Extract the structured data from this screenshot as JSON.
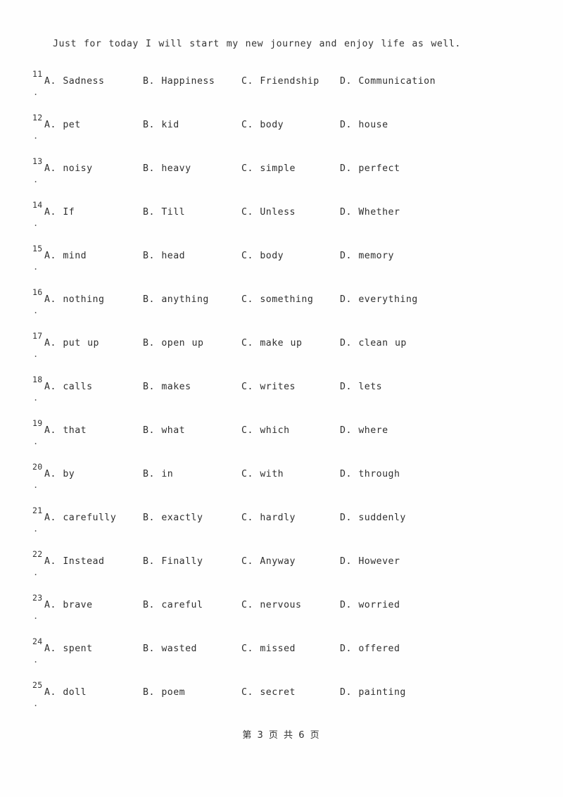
{
  "document": {
    "intro_line": "Just for today I will start my new journey and enjoy life as well.",
    "number_suffix": ".",
    "footer": "第 3 页 共 6 页"
  },
  "questions": [
    {
      "number": "11",
      "a": "A. Sadness",
      "b": "B. Happiness",
      "c": "C. Friendship",
      "d": "D. Communication"
    },
    {
      "number": "12",
      "a": "A. pet",
      "b": "B. kid",
      "c": "C. body",
      "d": "D. house"
    },
    {
      "number": "13",
      "a": "A. noisy",
      "b": "B. heavy",
      "c": "C. simple",
      "d": "D. perfect"
    },
    {
      "number": "14",
      "a": "A. If",
      "b": "B. Till",
      "c": "C. Unless",
      "d": "D. Whether"
    },
    {
      "number": "15",
      "a": "A. mind",
      "b": "B. head",
      "c": "C. body",
      "d": "D. memory"
    },
    {
      "number": "16",
      "a": "A. nothing",
      "b": "B. anything",
      "c": "C. something",
      "d": "D. everything"
    },
    {
      "number": "17",
      "a": "A. put up",
      "b": "B. open up",
      "c": "C. make up",
      "d": "D. clean up"
    },
    {
      "number": "18",
      "a": "A. calls",
      "b": "B. makes",
      "c": "C. writes",
      "d": "D. lets"
    },
    {
      "number": "19",
      "a": "A. that",
      "b": "B. what",
      "c": "C. which",
      "d": "D. where"
    },
    {
      "number": "20",
      "a": "A. by",
      "b": "B. in",
      "c": "C. with",
      "d": "D. through"
    },
    {
      "number": "21",
      "a": "A. carefully",
      "b": "B. exactly",
      "c": "C. hardly",
      "d": "D. suddenly"
    },
    {
      "number": "22",
      "a": "A. Instead",
      "b": "B. Finally",
      "c": "C. Anyway",
      "d": "D. However"
    },
    {
      "number": "23",
      "a": "A. brave",
      "b": "B. careful",
      "c": "C. nervous",
      "d": "D. worried"
    },
    {
      "number": "24",
      "a": "A. spent",
      "b": "B. wasted",
      "c": "C. missed",
      "d": "D. offered"
    },
    {
      "number": "25",
      "a": "A. doll",
      "b": "B. poem",
      "c": "C. secret",
      "d": "D. painting"
    }
  ]
}
